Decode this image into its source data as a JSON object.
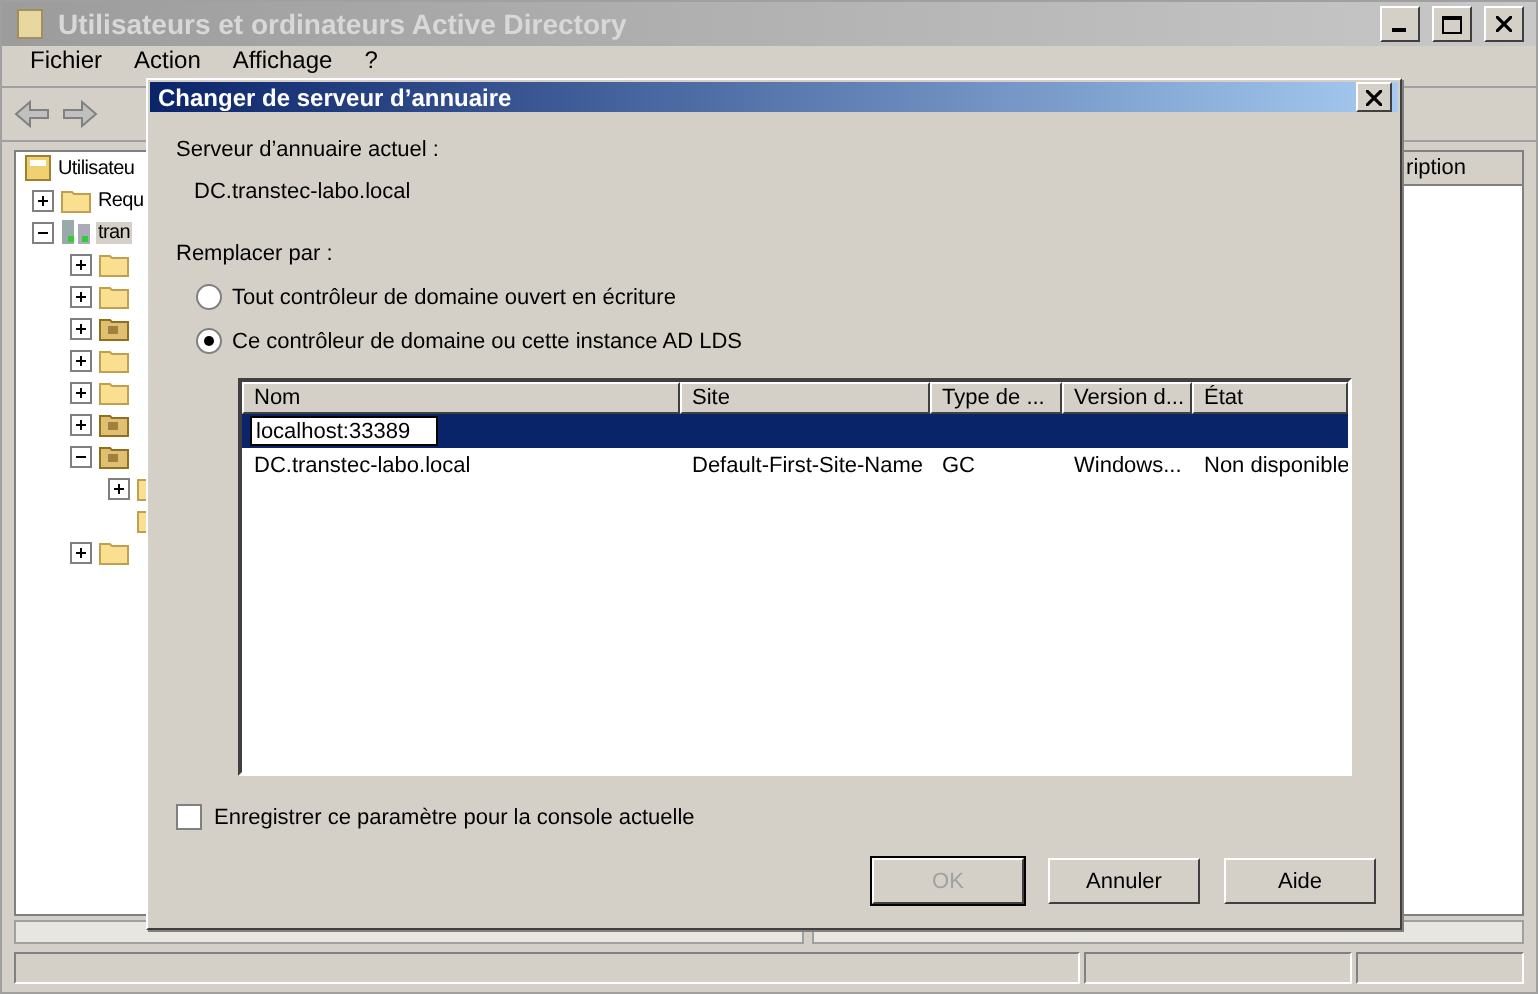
{
  "window": {
    "title": "Utilisateurs et ordinateurs Active Directory"
  },
  "menu": [
    "Fichier",
    "Action",
    "Affichage",
    "?"
  ],
  "tree": [
    {
      "label": "Utilisateu",
      "kind": "root",
      "children": [
        {
          "label": "Requ",
          "kind": "folder",
          "expanded": false
        },
        {
          "label": "tran",
          "kind": "domain",
          "expanded": true,
          "selected": true,
          "children": [
            {
              "kind": "folder",
              "expanded": false
            },
            {
              "kind": "folder",
              "expanded": false
            },
            {
              "kind": "ou",
              "expanded": false
            },
            {
              "kind": "folder",
              "expanded": false
            },
            {
              "kind": "folder",
              "expanded": false
            },
            {
              "kind": "ou",
              "expanded": false
            },
            {
              "kind": "ou",
              "expanded": true,
              "children": [
                {
                  "kind": "folder",
                  "expanded": false
                },
                {
                  "kind": "folder"
                }
              ]
            },
            {
              "kind": "folder",
              "expanded": false
            }
          ]
        }
      ]
    }
  ],
  "right_pane": {
    "column_header": "ription"
  },
  "dialog": {
    "title": "Changer de serveur d’annuaire",
    "current_label": "Serveur d’annuaire actuel :",
    "current_value": "DC.transtec-labo.local",
    "replace_label": "Remplacer par :",
    "options": [
      {
        "label": "Tout contrôleur de domaine ouvert en écriture",
        "selected": false
      },
      {
        "label": "Ce contrôleur de domaine ou cette instance AD LDS",
        "selected": true
      }
    ],
    "table": {
      "columns": [
        "Nom",
        "Site",
        "Type de ...",
        "Version d...",
        "État"
      ],
      "rows": [
        {
          "kind": "edit",
          "value": "localhost:33389",
          "selected": true
        },
        {
          "kind": "row",
          "cells": [
            "DC.transtec-labo.local",
            "Default-First-Site-Name",
            "GC",
            "Windows...",
            "Non disponible"
          ],
          "selected": false
        }
      ]
    },
    "save_setting": {
      "label": "Enregistrer ce paramètre pour la console actuelle",
      "checked": false
    },
    "buttons": [
      {
        "label": "OK",
        "disabled": true
      },
      {
        "label": "Annuler",
        "disabled": false
      },
      {
        "label": "Aide",
        "disabled": false
      }
    ]
  }
}
